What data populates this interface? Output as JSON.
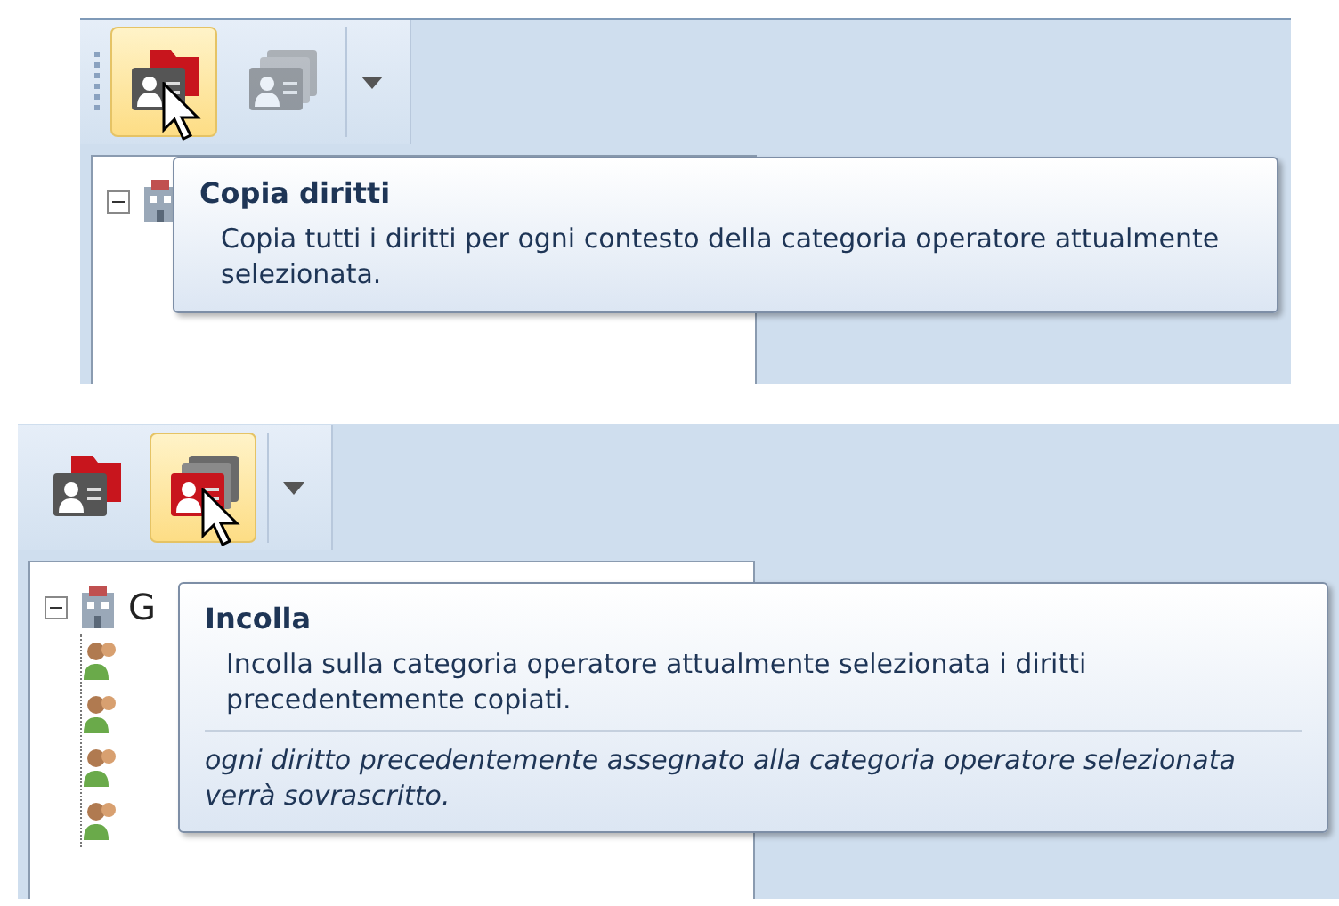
{
  "panels": [
    {
      "toolbar": {
        "buttons": [
          {
            "kind": "copy",
            "hovered": true,
            "disabled": false
          },
          {
            "kind": "paste",
            "hovered": false,
            "disabled": true
          }
        ]
      },
      "tree": {
        "root": {
          "expanded": true
        }
      },
      "tooltip": {
        "title": "Copia diritti",
        "text": "Copia tutti i diritti per ogni contesto della categoria operatore attualmente selezionata."
      }
    },
    {
      "toolbar": {
        "buttons": [
          {
            "kind": "copy",
            "hovered": false,
            "disabled": false
          },
          {
            "kind": "paste",
            "hovered": true,
            "disabled": false
          }
        ]
      },
      "tree": {
        "root": {
          "label": "G",
          "expanded": true,
          "children": [
            {
              "kind": "user"
            },
            {
              "kind": "user"
            },
            {
              "kind": "user"
            },
            {
              "kind": "user"
            }
          ]
        }
      },
      "tooltip": {
        "title": "Incolla",
        "text": "Incolla sulla categoria operatore attualmente selezionata i diritti precedentemente copiati.",
        "note": "ogni diritto precedentemente assegnato alla categoria operatore selezionata verrà sovrascritto."
      }
    }
  ]
}
